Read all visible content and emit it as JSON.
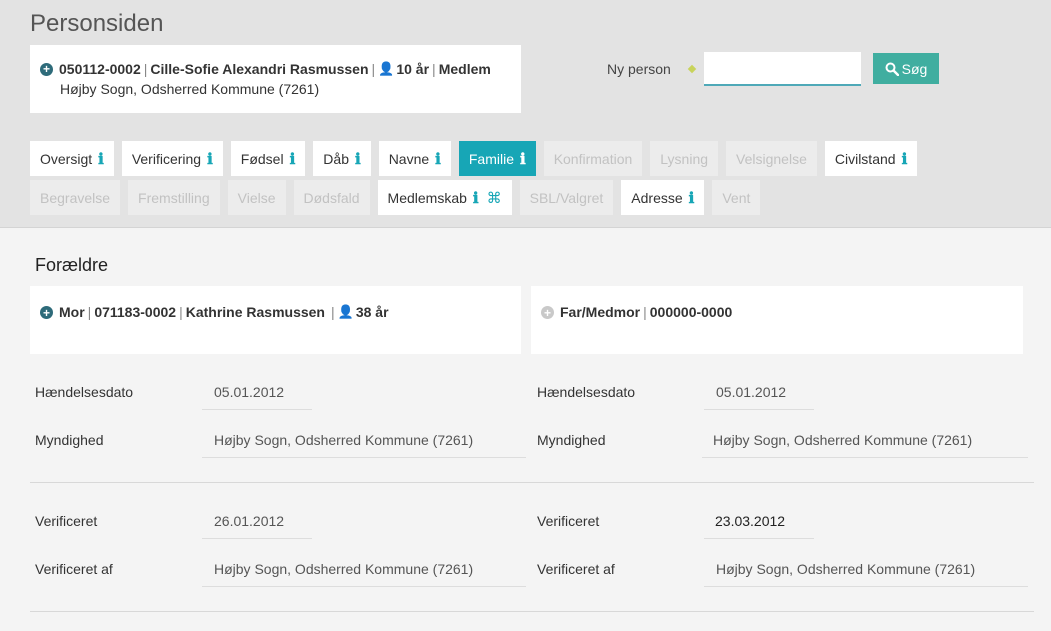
{
  "header": {
    "title": "Personsiden"
  },
  "person": {
    "cpr": "050112-0002",
    "name": "Cille-Sofie Alexandri Rasmussen",
    "age": "10 år",
    "status": "Medlem",
    "parish": "Højby Sogn, Odsherred Kommune (7261)"
  },
  "search": {
    "label": "Ny person",
    "value": "",
    "button_label": "Søg"
  },
  "tabs_row1": [
    {
      "label": "Oversigt",
      "state": "normal",
      "info": true
    },
    {
      "label": "Verificering",
      "state": "normal",
      "info": true
    },
    {
      "label": "Fødsel",
      "state": "normal",
      "info": true
    },
    {
      "label": "Dåb",
      "state": "normal",
      "info": true
    },
    {
      "label": "Navne",
      "state": "normal",
      "info": true
    },
    {
      "label": "Familie",
      "state": "active",
      "info": true
    },
    {
      "label": "Konfirmation",
      "state": "disabled",
      "info": false
    },
    {
      "label": "Lysning",
      "state": "disabled",
      "info": false
    },
    {
      "label": "Velsignelse",
      "state": "disabled",
      "info": false
    },
    {
      "label": "Civilstand",
      "state": "normal",
      "info": true
    }
  ],
  "tabs_row2": [
    {
      "label": "Begravelse",
      "state": "disabled",
      "info": false
    },
    {
      "label": "Fremstilling",
      "state": "disabled",
      "info": false
    },
    {
      "label": "Vielse",
      "state": "disabled",
      "info": false
    },
    {
      "label": "Dødsfald",
      "state": "disabled",
      "info": false
    },
    {
      "label": "Medlemskab",
      "state": "normal",
      "info": true,
      "cmd": true
    },
    {
      "label": "SBL/Valgret",
      "state": "disabled",
      "info": false
    },
    {
      "label": "Adresse",
      "state": "normal",
      "info": true
    },
    {
      "label": "Vent",
      "state": "disabled",
      "info": false
    }
  ],
  "icons": {
    "info": "ℹ",
    "cmd": "⌘"
  },
  "section": {
    "title": "Forældre"
  },
  "mother": {
    "role": "Mor",
    "cpr": "071183-0002",
    "name": "Kathrine Rasmussen",
    "age": "38 år"
  },
  "father": {
    "role": "Far/Medmor",
    "cpr": "000000-0000"
  },
  "mother_details": {
    "event_date_label": "Hændelsesdato",
    "event_date": "05.01.2012",
    "authority_label": "Myndighed",
    "authority": "Højby Sogn, Odsherred Kommune (7261)",
    "verified_label": "Verificeret",
    "verified": "26.01.2012",
    "verified_by_label": "Verificeret af",
    "verified_by": "Højby Sogn, Odsherred Kommune (7261)"
  },
  "father_details": {
    "event_date_label": "Hændelsesdato",
    "event_date": "05.01.2012",
    "authority_label": "Myndighed",
    "authority": "Højby Sogn, Odsherred Kommune (7261)",
    "verified_label": "Verificeret",
    "verified": "23.03.2012",
    "verified_by_label": "Verificeret af",
    "verified_by": "Højby Sogn, Odsherred Kommune (7261)"
  }
}
